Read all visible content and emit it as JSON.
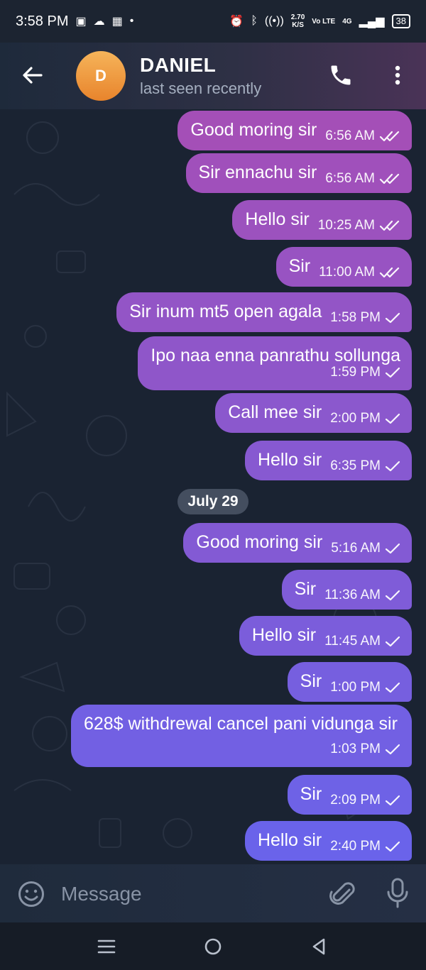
{
  "status_bar": {
    "time": "3:58 PM",
    "net_speed_value": "2.70",
    "net_speed_unit": "K/S",
    "network": "4G",
    "volte": "Vo LTE",
    "battery": "38"
  },
  "header": {
    "avatar_letter": "D",
    "contact_name": "DANIEL",
    "contact_status": "last seen recently"
  },
  "chat": {
    "date_separator": "July 29",
    "messages": [
      {
        "text": "Good moring sir",
        "time": "6:56 AM",
        "read": true
      },
      {
        "text": "Sir ennachu sir",
        "time": "6:56 AM",
        "read": true
      },
      {
        "text": "Hello sir",
        "time": "10:25 AM",
        "read": true
      },
      {
        "text": "Sir",
        "time": "11:00 AM",
        "read": true
      },
      {
        "text": "Sir inum mt5 open agala",
        "time": "1:58 PM",
        "read": false
      },
      {
        "text": "Ipo naa enna panrathu sollunga",
        "time": "1:59 PM",
        "read": false
      },
      {
        "text": "Call mee sir",
        "time": "2:00 PM",
        "read": false
      },
      {
        "text": "Hello sir",
        "time": "6:35 PM",
        "read": false
      },
      {
        "text": "Good moring sir",
        "time": "5:16 AM",
        "read": false
      },
      {
        "text": "Sir",
        "time": "11:36 AM",
        "read": false
      },
      {
        "text": "Hello sir",
        "time": "11:45 AM",
        "read": false
      },
      {
        "text": "Sir",
        "time": "1:00 PM",
        "read": false
      },
      {
        "text": "628$ withdrewal cancel pani vidunga sir",
        "time": "1:03 PM",
        "read": false
      },
      {
        "text": "Sir",
        "time": "2:09 PM",
        "read": false
      },
      {
        "text": "Hello sir",
        "time": "2:40 PM",
        "read": false
      }
    ]
  },
  "input": {
    "placeholder": "Message"
  },
  "colors": {
    "bubble_top": "#a44fb7",
    "bubble_bottom": "#6a63ea",
    "avatar": "#ef9a40"
  }
}
